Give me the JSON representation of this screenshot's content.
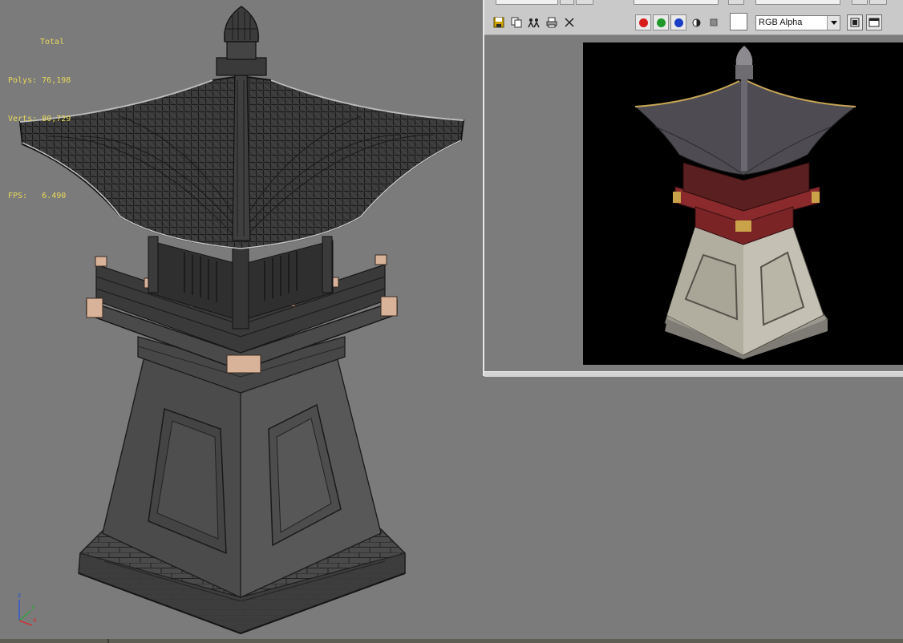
{
  "viewport": {
    "stats": {
      "header": "Total",
      "polys_label": "Polys:",
      "polys_value": "76,198",
      "verts_label": "Verts:",
      "verts_value": "80,729",
      "fps_label": "FPS:",
      "fps_value": "6.490"
    },
    "gizmo": {
      "z": "z",
      "y": "y",
      "x": "x"
    }
  },
  "render_window": {
    "toolbar": {
      "icons": [
        "save-icon",
        "copy-icon",
        "clone-icon",
        "print-icon",
        "clear-icon"
      ],
      "channels": [
        {
          "name": "red-channel",
          "color": "#d81c1c"
        },
        {
          "name": "green-channel",
          "color": "#1f9a2a"
        },
        {
          "name": "blue-channel",
          "color": "#1b3fc4"
        }
      ],
      "channel_select": "RGB Alpha",
      "color_swatch": "#ffffff"
    }
  },
  "colors": {
    "viewport_bg": "#7b7b7b",
    "stats_text": "#e8d85a",
    "render_bg": "#000000"
  }
}
